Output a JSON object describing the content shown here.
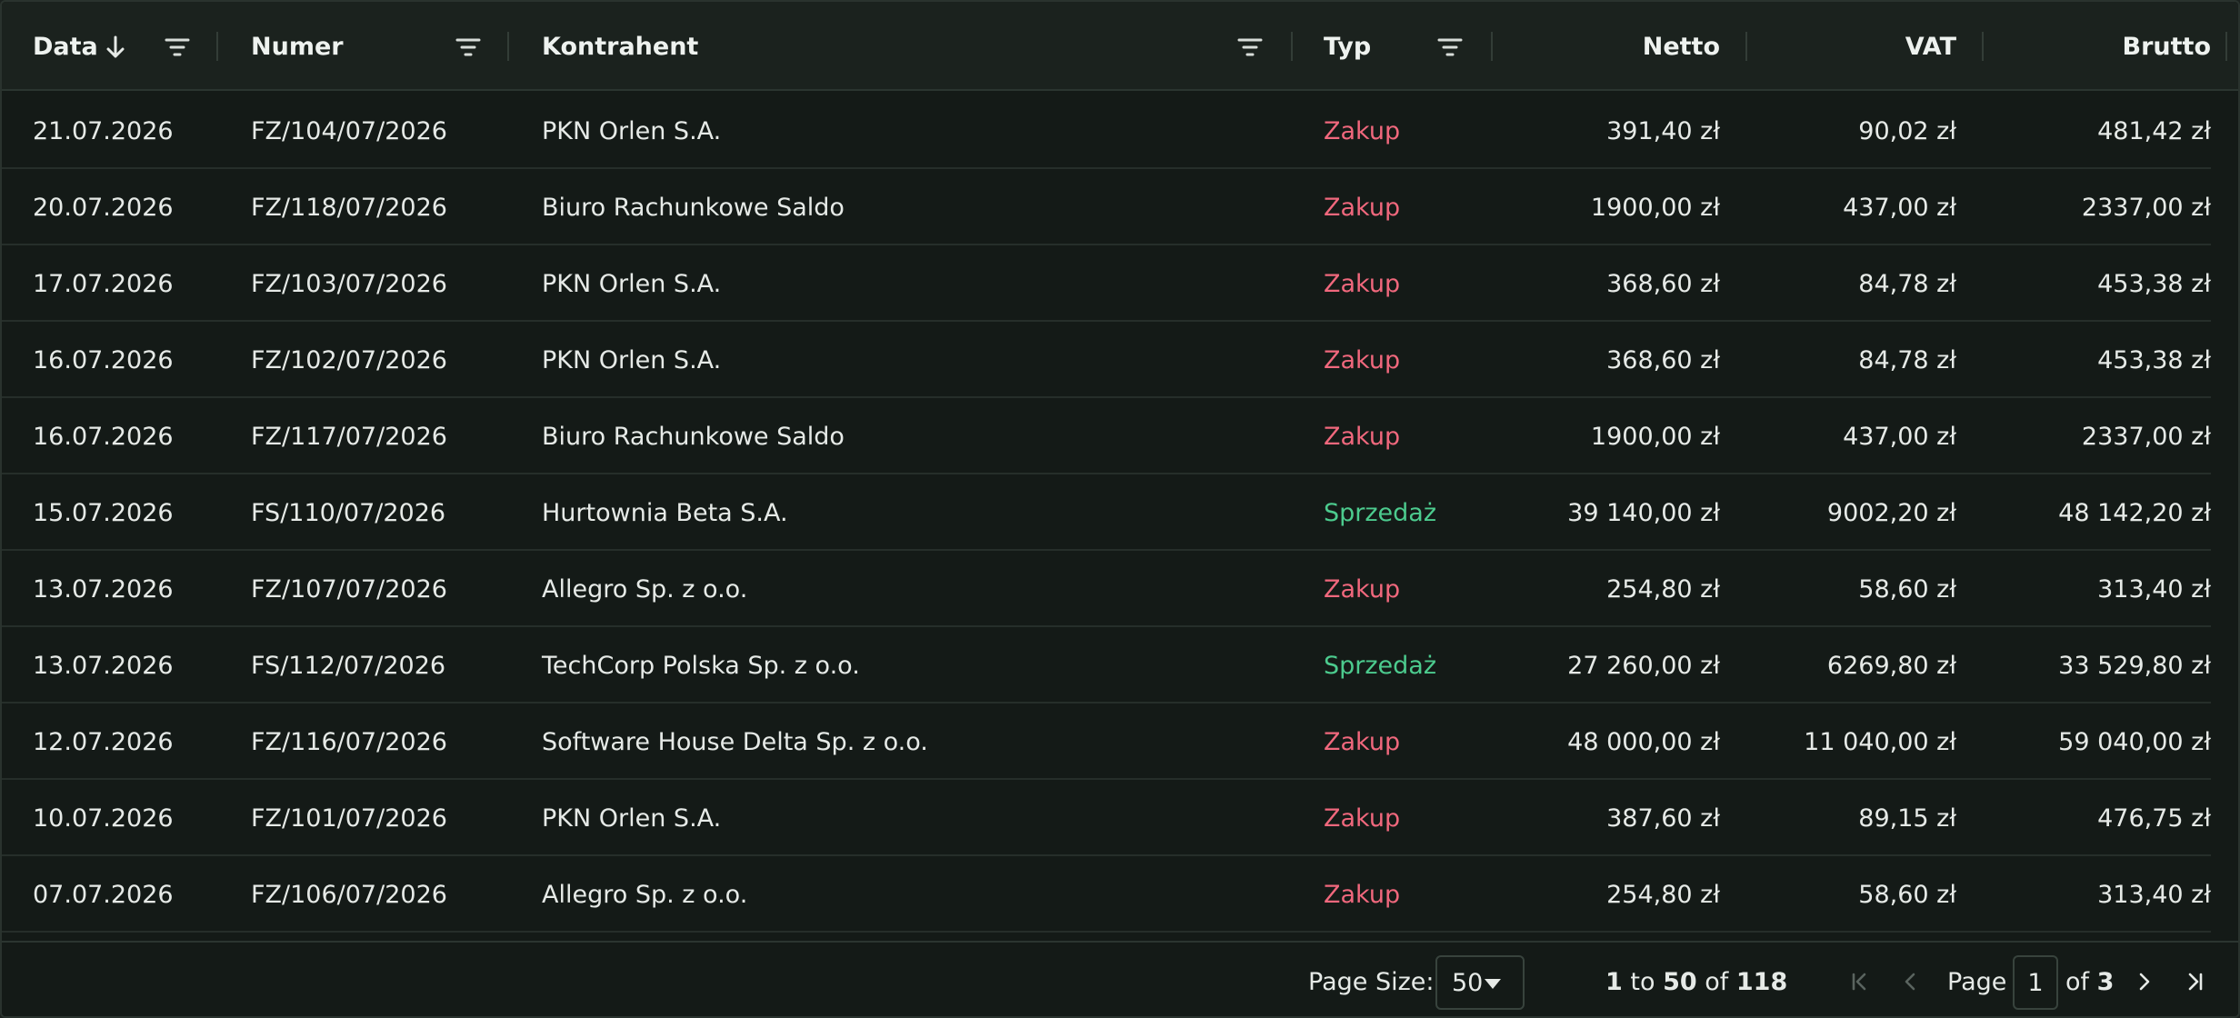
{
  "columns": {
    "data": "Data",
    "numer": "Numer",
    "kontrahent": "Kontrahent",
    "typ": "Typ",
    "netto": "Netto",
    "vat": "VAT",
    "brutto": "Brutto"
  },
  "rows": [
    {
      "data": "21.07.2026",
      "numer": "FZ/104/07/2026",
      "kontrahent": "PKN Orlen S.A.",
      "typ": "Zakup",
      "typ_kind": "zakup",
      "netto": "391,40 zł",
      "vat": "90,02 zł",
      "brutto": "481,42 zł"
    },
    {
      "data": "20.07.2026",
      "numer": "FZ/118/07/2026",
      "kontrahent": "Biuro Rachunkowe Saldo",
      "typ": "Zakup",
      "typ_kind": "zakup",
      "netto": "1900,00 zł",
      "vat": "437,00 zł",
      "brutto": "2337,00 zł"
    },
    {
      "data": "17.07.2026",
      "numer": "FZ/103/07/2026",
      "kontrahent": "PKN Orlen S.A.",
      "typ": "Zakup",
      "typ_kind": "zakup",
      "netto": "368,60 zł",
      "vat": "84,78 zł",
      "brutto": "453,38 zł"
    },
    {
      "data": "16.07.2026",
      "numer": "FZ/102/07/2026",
      "kontrahent": "PKN Orlen S.A.",
      "typ": "Zakup",
      "typ_kind": "zakup",
      "netto": "368,60 zł",
      "vat": "84,78 zł",
      "brutto": "453,38 zł"
    },
    {
      "data": "16.07.2026",
      "numer": "FZ/117/07/2026",
      "kontrahent": "Biuro Rachunkowe Saldo",
      "typ": "Zakup",
      "typ_kind": "zakup",
      "netto": "1900,00 zł",
      "vat": "437,00 zł",
      "brutto": "2337,00 zł"
    },
    {
      "data": "15.07.2026",
      "numer": "FS/110/07/2026",
      "kontrahent": "Hurtownia Beta S.A.",
      "typ": "Sprzedaż",
      "typ_kind": "sprzedaz",
      "netto": "39 140,00 zł",
      "vat": "9002,20 zł",
      "brutto": "48 142,20 zł"
    },
    {
      "data": "13.07.2026",
      "numer": "FZ/107/07/2026",
      "kontrahent": "Allegro Sp. z o.o.",
      "typ": "Zakup",
      "typ_kind": "zakup",
      "netto": "254,80 zł",
      "vat": "58,60 zł",
      "brutto": "313,40 zł"
    },
    {
      "data": "13.07.2026",
      "numer": "FS/112/07/2026",
      "kontrahent": "TechCorp Polska Sp. z o.o.",
      "typ": "Sprzedaż",
      "typ_kind": "sprzedaz",
      "netto": "27 260,00 zł",
      "vat": "6269,80 zł",
      "brutto": "33 529,80 zł"
    },
    {
      "data": "12.07.2026",
      "numer": "FZ/116/07/2026",
      "kontrahent": "Software House Delta Sp. z o.o.",
      "typ": "Zakup",
      "typ_kind": "zakup",
      "netto": "48 000,00 zł",
      "vat": "11 040,00 zł",
      "brutto": "59 040,00 zł"
    },
    {
      "data": "10.07.2026",
      "numer": "FZ/101/07/2026",
      "kontrahent": "PKN Orlen S.A.",
      "typ": "Zakup",
      "typ_kind": "zakup",
      "netto": "387,60 zł",
      "vat": "89,15 zł",
      "brutto": "476,75 zł"
    },
    {
      "data": "07.07.2026",
      "numer": "FZ/106/07/2026",
      "kontrahent": "Allegro Sp. z o.o.",
      "typ": "Zakup",
      "typ_kind": "zakup",
      "netto": "254,80 zł",
      "vat": "58,60 zł",
      "brutto": "313,40 zł"
    }
  ],
  "footer": {
    "page_size_label": "Page Size:",
    "page_size_value": "50",
    "range_from": "1",
    "range_to_word": "to",
    "range_to": "50",
    "range_of_word": "of",
    "total": "118",
    "page_label": "Page",
    "current_page": "1",
    "of_pages_word": "of",
    "total_pages": "3"
  },
  "colors": {
    "zakup": "#f0687d",
    "sprzedaz": "#4ccb8e",
    "background": "#141a17"
  },
  "icons": {
    "sort": "arrow-down-icon",
    "filter": "filter-icon",
    "first": "first-page-icon",
    "prev": "previous-page-icon",
    "next": "next-page-icon",
    "last": "last-page-icon"
  }
}
